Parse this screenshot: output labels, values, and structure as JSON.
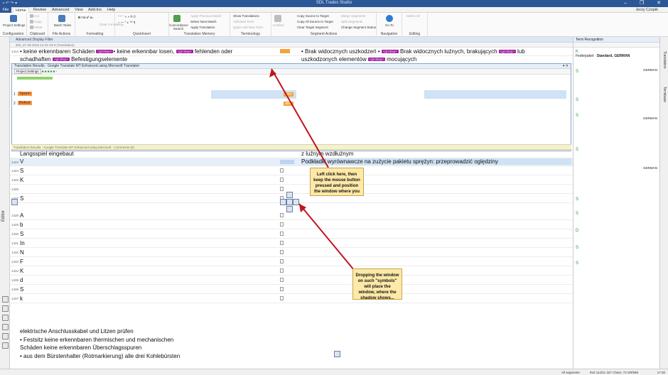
{
  "title": {
    "app": "SDL Trados Studio"
  },
  "window_controls": "–  ❐  ✕",
  "tabs": [
    "File",
    "Home",
    "Review",
    "Advanced",
    "View",
    "Add-Ins",
    "Help"
  ],
  "user": "Jerzy Czopik",
  "ribbon": {
    "configuration": {
      "label": "Configuration",
      "btn": "Project Settings"
    },
    "clipboard": {
      "label": "Clipboard",
      "items": [
        "Cut",
        "Copy",
        "Paste"
      ]
    },
    "file_actions": {
      "label": "File Actions",
      "btn": "Batch Tasks"
    },
    "formatting": {
      "label": "Formatting",
      "items": [
        "Clear Formatting"
      ]
    },
    "quickinsert": {
      "label": "QuickInsert"
    },
    "tm": {
      "label": "Translation Memory",
      "concordance": "Concordance Search",
      "items": [
        "Apply Previous Match",
        "Select Next Match",
        "Apply Translation"
      ]
    },
    "terminology": {
      "label": "Terminology",
      "items": [
        "Show Translations",
        "Add New Term",
        "Quick Add New Term"
      ]
    },
    "confirm": "Confirm",
    "segment_actions": {
      "label": "Segment Actions",
      "items": [
        "Copy Source to Target",
        "Copy All Source to Target",
        "Clear Target Segment",
        "Merge Segments",
        "Split Segments",
        "Change Segment Status"
      ]
    },
    "navigation": {
      "label": "Navigation",
      "btn": "Go To"
    },
    "editing": {
      "label": "Editing",
      "btn": "Select All"
    }
  },
  "left_panel": {
    "label": "Editor"
  },
  "filter": "Advanced Display Filter",
  "doc_path": "802_07-20-2016 14-31-33-9  (Translation)",
  "segments": [
    {
      "n": "1414",
      "src_a": "keine erkennbaren Schäden ",
      "tag1": "<gt:nbsp>",
      "src_b": " keine erkennbar losen, ",
      "tag2": "<gt:nbsp>",
      "src_c": " fehlenden oder",
      "tgt_a": "Brak widocznych uszkodzeń • ",
      "tgt_tag": "<gt:nbsp>",
      "tgt_b": " Brak widocznych luźnych, brakujących ",
      "tgt_tag2": "<gt:nbsp>",
      "tgt_c": " lub"
    },
    {
      "n": "",
      "src_a": "schadhaften ",
      "tag1": "<gt:nbsp>",
      "src_b": " Befestigungselemente",
      "tgt_a": "uszkodzonych elementów ",
      "tgt_tag": "<gt:nbsp>",
      "tgt_b": " mocujących"
    }
  ],
  "translation_results": {
    "title": "Translation Results",
    "source_label": "Google Translate MT Enhanced using Microsoft Translator",
    "toolbar": "Project Settings",
    "rows": [
      {
        "n": "1",
        "text": "Spann",
        "pct": "59%"
      },
      {
        "n": "2",
        "text": "Befest",
        "pct": "58%"
      }
    ],
    "footer_date": "26.02.2016 22:02:29",
    "dock_tabs": "Translation Results  ·  Google Translate MT Enhanced using Microsoft  ·  Comments (0)"
  },
  "segments2": [
    {
      "n": "1422",
      "src": "Langsspiel eingebaut",
      "tgt": "z luźnym wzdłużnym"
    },
    {
      "n": "1423",
      "src": "V",
      "tgt": "Podkładki wyrównawcze na zużycie pakietu sprężyn: przeprowadzić oględziny",
      "hl": true
    },
    {
      "n": "1424",
      "src": "S",
      "tgt": ""
    },
    {
      "n": "1425",
      "src": "K",
      "tgt": ""
    },
    {
      "n": "1426",
      "src": "",
      "tgt": ""
    },
    {
      "n": "1427",
      "src": "S",
      "tgt": ""
    },
    {
      "n": "1428",
      "src": "A",
      "tgt": ""
    },
    {
      "n": "1429",
      "src": "b",
      "tgt": ""
    },
    {
      "n": "1430",
      "src": "S",
      "tgt": ""
    },
    {
      "n": "1431",
      "src": "In",
      "tgt": ""
    },
    {
      "n": "1432",
      "src": "N",
      "tgt": ""
    },
    {
      "n": "1433",
      "src": "F",
      "tgt": ""
    },
    {
      "n": "1434",
      "src": "K",
      "tgt": ""
    },
    {
      "n": "1435",
      "src": "d",
      "tgt": ""
    },
    {
      "n": "1436",
      "src": "S",
      "tgt": ""
    },
    {
      "n": "1437",
      "src": "k",
      "tgt": ""
    }
  ],
  "bottom_text": [
    "elektrische Anschlusskabel und Litzen prüfen",
    "Festsitz  keine erkennbaren  thermischen und  mechanischen",
    "Schäden  keine erkennbaren  Überschlagsspuren",
    "aus dem Bürstenhalter (Rotmarkierung) alle  drei Kohlebürsten"
  ],
  "callouts": {
    "c1": "Left click here, then keep the mouse button pressed and position the window where you",
    "c2": "Dropping the window on such \"symbols\" will place the window, where the shadow shows..."
  },
  "right_panel": {
    "title": "Term Recognition",
    "fp_label": "Federpaket",
    "fp_value": "Standard, GERMAN",
    "lang": "GERMAN",
    "footer": "Term Recognition   Termbase Search"
  },
  "right_strip": [
    "Translation",
    "Termbase"
  ],
  "status": {
    "left": "All segments",
    "mid": "INS  114/21  327  Chars: 72  0/0/599",
    "time": "17:30"
  }
}
